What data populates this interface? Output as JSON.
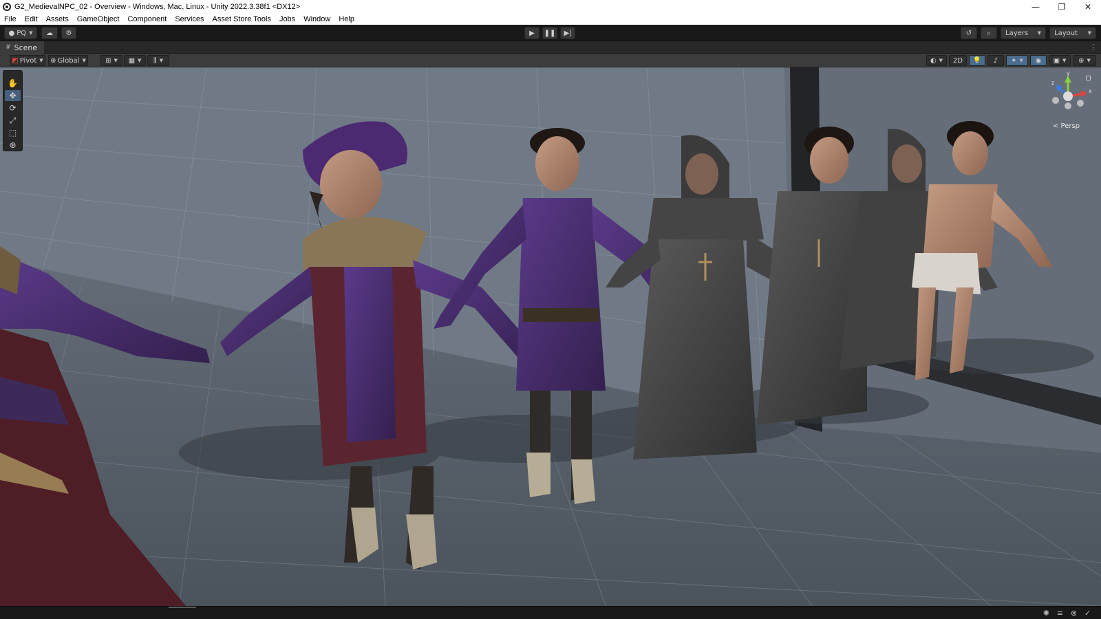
{
  "window": {
    "title": "G2_MedievalNPC_02 - Overview - Windows, Mac, Linux - Unity 2022.3.38f1 <DX12>",
    "controls": {
      "minimize": "—",
      "restore": "❐",
      "close": "✕"
    }
  },
  "menu": {
    "items": [
      "File",
      "Edit",
      "Assets",
      "GameObject",
      "Component",
      "Services",
      "Asset Store Tools",
      "Jobs",
      "Window",
      "Help"
    ]
  },
  "toolbar": {
    "account": "PQ",
    "layers_label": "Layers",
    "layout_label": "Layout",
    "play_icon": "play-icon",
    "pause_icon": "pause-icon",
    "step_icon": "step-icon"
  },
  "scene_tab": {
    "label": "Scene"
  },
  "scene_toolbar": {
    "pivot_label": "Pivot",
    "global_label": "Global",
    "mode_2d": "2D"
  },
  "viewport": {
    "camera_label": "< Persp",
    "gizmo_axes": {
      "y": "y",
      "x": "x",
      "z": "z"
    }
  },
  "colors": {
    "accent": "#46607c",
    "background": "#191919",
    "panel": "#3c3c3c",
    "viewport_sky": "#747d88",
    "gizmo_x": "#e0433a",
    "gizmo_y": "#8ad13f",
    "gizmo_z": "#3a7de0"
  }
}
